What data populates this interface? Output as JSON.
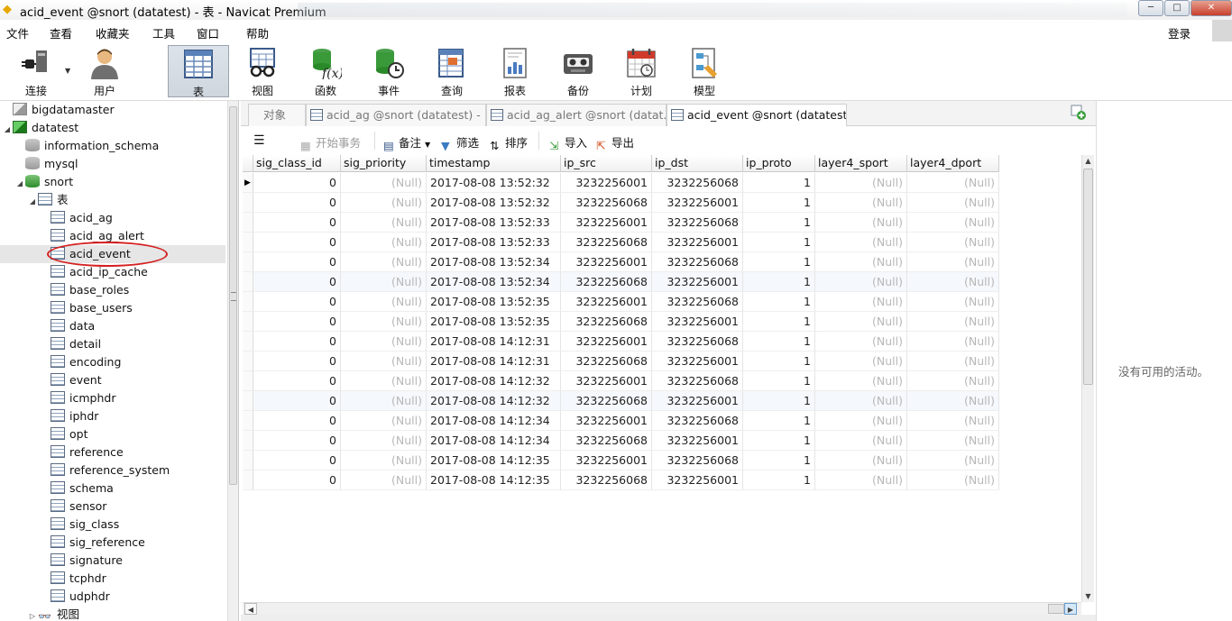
{
  "window": {
    "title": "acid_event @snort (datatest) - 表 - Navicat Premium",
    "controls": {
      "minimize": "─",
      "maximize": "□",
      "close": "✕"
    }
  },
  "menu": {
    "items": [
      "文件",
      "查看",
      "收藏夹",
      "工具",
      "窗口",
      "帮助"
    ],
    "login": "登录"
  },
  "toolbar": {
    "buttons": [
      {
        "label": "连接",
        "icon": "connection-plug-icon"
      },
      {
        "label": "用户",
        "icon": "user-icon"
      },
      {
        "label": "表",
        "icon": "table-icon",
        "active": true
      },
      {
        "label": "视图",
        "icon": "view-glasses-icon"
      },
      {
        "label": "函数",
        "icon": "function-fx-icon"
      },
      {
        "label": "事件",
        "icon": "event-clock-icon"
      },
      {
        "label": "查询",
        "icon": "query-icon"
      },
      {
        "label": "报表",
        "icon": "report-chart-icon"
      },
      {
        "label": "备份",
        "icon": "backup-tape-icon"
      },
      {
        "label": "计划",
        "icon": "schedule-calendar-icon"
      },
      {
        "label": "模型",
        "icon": "model-icon"
      }
    ]
  },
  "tree": {
    "connections": [
      {
        "label": "bigdatamaster"
      },
      {
        "label": "datatest"
      }
    ],
    "databases": [
      "information_schema",
      "mysql",
      "snort"
    ],
    "tables_group": "表",
    "tables": [
      "acid_ag",
      "acid_ag_alert",
      "acid_event",
      "acid_ip_cache",
      "base_roles",
      "base_users",
      "data",
      "detail",
      "encoding",
      "event",
      "icmphdr",
      "iphdr",
      "opt",
      "reference",
      "reference_system",
      "schema",
      "sensor",
      "sig_class",
      "sig_reference",
      "signature",
      "tcphdr",
      "udphdr"
    ],
    "selected_table": "acid_event",
    "views_group": "视图"
  },
  "tabs": [
    {
      "label": "对象"
    },
    {
      "label": "acid_ag @snort (datatest) - ..."
    },
    {
      "label": "acid_ag_alert @snort (datat..."
    },
    {
      "label": "acid_event @snort (datatest..."
    }
  ],
  "subtoolbar": {
    "begin_tx": "开始事务",
    "memo": "备注",
    "filter": "筛选",
    "sort": "排序",
    "import": "导入",
    "export": "导出"
  },
  "grid": {
    "columns": [
      "sig_class_id",
      "sig_priority",
      "timestamp",
      "ip_src",
      "ip_dst",
      "ip_proto",
      "layer4_sport",
      "layer4_dport"
    ],
    "rows": [
      [
        "0",
        "(Null)",
        "2017-08-08 13:52:32",
        "3232256001",
        "3232256068",
        "1",
        "(Null)",
        "(Null)"
      ],
      [
        "0",
        "(Null)",
        "2017-08-08 13:52:32",
        "3232256068",
        "3232256001",
        "1",
        "(Null)",
        "(Null)"
      ],
      [
        "0",
        "(Null)",
        "2017-08-08 13:52:33",
        "3232256001",
        "3232256068",
        "1",
        "(Null)",
        "(Null)"
      ],
      [
        "0",
        "(Null)",
        "2017-08-08 13:52:33",
        "3232256068",
        "3232256001",
        "1",
        "(Null)",
        "(Null)"
      ],
      [
        "0",
        "(Null)",
        "2017-08-08 13:52:34",
        "3232256001",
        "3232256068",
        "1",
        "(Null)",
        "(Null)"
      ],
      [
        "0",
        "(Null)",
        "2017-08-08 13:52:34",
        "3232256068",
        "3232256001",
        "1",
        "(Null)",
        "(Null)"
      ],
      [
        "0",
        "(Null)",
        "2017-08-08 13:52:35",
        "3232256001",
        "3232256068",
        "1",
        "(Null)",
        "(Null)"
      ],
      [
        "0",
        "(Null)",
        "2017-08-08 13:52:35",
        "3232256068",
        "3232256001",
        "1",
        "(Null)",
        "(Null)"
      ],
      [
        "0",
        "(Null)",
        "2017-08-08 14:12:31",
        "3232256001",
        "3232256068",
        "1",
        "(Null)",
        "(Null)"
      ],
      [
        "0",
        "(Null)",
        "2017-08-08 14:12:31",
        "3232256068",
        "3232256001",
        "1",
        "(Null)",
        "(Null)"
      ],
      [
        "0",
        "(Null)",
        "2017-08-08 14:12:32",
        "3232256001",
        "3232256068",
        "1",
        "(Null)",
        "(Null)"
      ],
      [
        "0",
        "(Null)",
        "2017-08-08 14:12:32",
        "3232256068",
        "3232256001",
        "1",
        "(Null)",
        "(Null)"
      ],
      [
        "0",
        "(Null)",
        "2017-08-08 14:12:34",
        "3232256001",
        "3232256068",
        "1",
        "(Null)",
        "(Null)"
      ],
      [
        "0",
        "(Null)",
        "2017-08-08 14:12:34",
        "3232256068",
        "3232256001",
        "1",
        "(Null)",
        "(Null)"
      ],
      [
        "0",
        "(Null)",
        "2017-08-08 14:12:35",
        "3232256001",
        "3232256068",
        "1",
        "(Null)",
        "(Null)"
      ],
      [
        "0",
        "(Null)",
        "2017-08-08 14:12:35",
        "3232256068",
        "3232256001",
        "1",
        "(Null)",
        "(Null)"
      ]
    ]
  },
  "right_panel": {
    "message": "没有可用的活动。"
  }
}
